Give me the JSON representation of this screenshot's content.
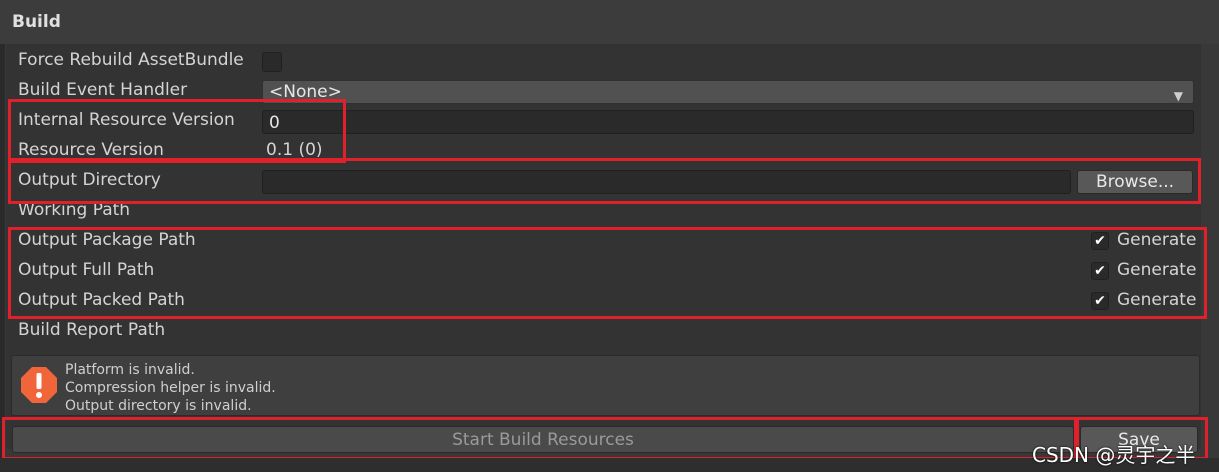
{
  "header": {
    "title": "Build"
  },
  "fields": {
    "force_rebuild_label": "Force Rebuild AssetBundle",
    "force_rebuild_checked": false,
    "build_event_label": "Build Event Handler",
    "build_event_value": "<None>",
    "internal_version_label": "Internal Resource Version",
    "internal_version_value": "0",
    "resource_version_label": "Resource Version",
    "resource_version_value": "0.1 (0)",
    "output_dir_label": "Output Directory",
    "output_dir_value": "",
    "browse_label": "Browse...",
    "working_path_label": "Working Path",
    "output_package_label": "Output Package Path",
    "output_full_label": "Output Full Path",
    "output_packed_label": "Output Packed Path",
    "generate_label": "Generate",
    "build_report_label": "Build Report Path"
  },
  "messages": [
    "Platform is invalid.",
    "Compression helper is invalid.",
    "Output directory is invalid."
  ],
  "actions": {
    "start_build_label": "Start Build Resources",
    "save_label": "Save"
  },
  "watermark": "CSDN @灵宇之半",
  "colors": {
    "background": "#383838",
    "annotation_red": "#e0202a",
    "warning_orange": "#f0663a"
  },
  "icons": {
    "warning": "warning-icon",
    "dropdown": "triangle-down-icon",
    "check": "checkmark-icon"
  }
}
